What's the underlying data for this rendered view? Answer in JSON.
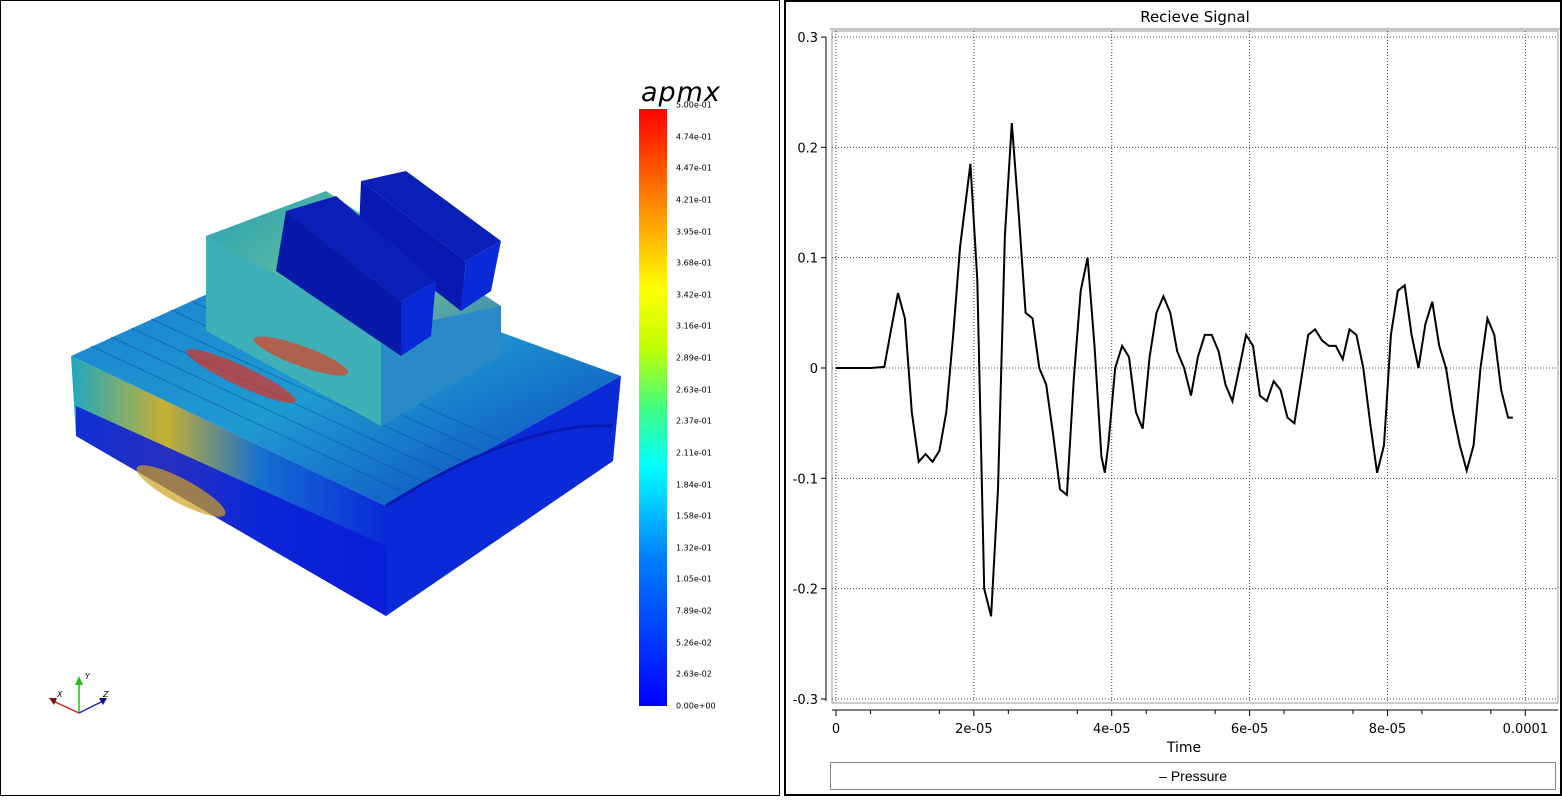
{
  "left_view": {
    "colorbar": {
      "title": "apmx",
      "ticks": [
        "5.00e-01",
        "4.74e-01",
        "4.47e-01",
        "4.21e-01",
        "3.95e-01",
        "3.68e-01",
        "3.42e-01",
        "3.16e-01",
        "2.89e-01",
        "2.63e-01",
        "2.37e-01",
        "2.11e-01",
        "1.84e-01",
        "1.58e-01",
        "1.32e-01",
        "1.05e-01",
        "7.89e-02",
        "5.26e-02",
        "2.63e-02",
        "0.00e+00"
      ]
    },
    "axes_triad": {
      "x_label": "X",
      "y_label": "Y",
      "z_label": "Z"
    }
  },
  "chart_data": {
    "type": "line",
    "title": "Recieve Signal",
    "xlabel": "Time",
    "ylabel": "",
    "xlim": [
      0,
      0.000103
    ],
    "ylim": [
      -0.3,
      0.3
    ],
    "x_ticks": [
      "0",
      "2e-05",
      "4e-05",
      "6e-05",
      "8e-05",
      "0.0001"
    ],
    "y_ticks": [
      "0.3",
      "0.2",
      "0.1",
      "0",
      "-0.1",
      "-0.2",
      "-0.3"
    ],
    "grid": true,
    "legend": "bottom",
    "series": [
      {
        "name": "Pressure",
        "color": "#000000",
        "points": [
          [
            0,
            0
          ],
          [
            5e-06,
            0
          ],
          [
            7e-06,
            0.001
          ],
          [
            8e-06,
            0.035
          ],
          [
            9e-06,
            0.068
          ],
          [
            1e-05,
            0.045
          ],
          [
            1.1e-05,
            -0.04
          ],
          [
            1.2e-05,
            -0.085
          ],
          [
            1.3e-05,
            -0.078
          ],
          [
            1.4e-05,
            -0.085
          ],
          [
            1.5e-05,
            -0.075
          ],
          [
            1.6e-05,
            -0.04
          ],
          [
            1.7e-05,
            0.03
          ],
          [
            1.8e-05,
            0.11
          ],
          [
            1.95e-05,
            0.185
          ],
          [
            2.05e-05,
            0.08
          ],
          [
            2.15e-05,
            -0.2
          ],
          [
            2.25e-05,
            -0.225
          ],
          [
            2.35e-05,
            -0.11
          ],
          [
            2.45e-05,
            0.12
          ],
          [
            2.55e-05,
            0.222
          ],
          [
            2.65e-05,
            0.14
          ],
          [
            2.75e-05,
            0.05
          ],
          [
            2.85e-05,
            0.045
          ],
          [
            2.95e-05,
            0.0
          ],
          [
            3.05e-05,
            -0.015
          ],
          [
            3.15e-05,
            -0.06
          ],
          [
            3.25e-05,
            -0.11
          ],
          [
            3.35e-05,
            -0.115
          ],
          [
            3.45e-05,
            -0.01
          ],
          [
            3.55e-05,
            0.07
          ],
          [
            3.65e-05,
            0.1
          ],
          [
            3.75e-05,
            0.02
          ],
          [
            3.85e-05,
            -0.08
          ],
          [
            3.9e-05,
            -0.095
          ],
          [
            3.95e-05,
            -0.07
          ],
          [
            4.05e-05,
            0.0
          ],
          [
            4.15e-05,
            0.02
          ],
          [
            4.25e-05,
            0.01
          ],
          [
            4.35e-05,
            -0.04
          ],
          [
            4.45e-05,
            -0.055
          ],
          [
            4.55e-05,
            0.01
          ],
          [
            4.65e-05,
            0.05
          ],
          [
            4.75e-05,
            0.065
          ],
          [
            4.85e-05,
            0.05
          ],
          [
            4.95e-05,
            0.015
          ],
          [
            5.05e-05,
            0.0
          ],
          [
            5.15e-05,
            -0.025
          ],
          [
            5.25e-05,
            0.01
          ],
          [
            5.35e-05,
            0.03
          ],
          [
            5.45e-05,
            0.03
          ],
          [
            5.55e-05,
            0.015
          ],
          [
            5.65e-05,
            -0.015
          ],
          [
            5.75e-05,
            -0.03
          ],
          [
            5.85e-05,
            0.0
          ],
          [
            5.95e-05,
            0.03
          ],
          [
            6.05e-05,
            0.02
          ],
          [
            6.15e-05,
            -0.025
          ],
          [
            6.25e-05,
            -0.03
          ],
          [
            6.35e-05,
            -0.012
          ],
          [
            6.45e-05,
            -0.02
          ],
          [
            6.55e-05,
            -0.045
          ],
          [
            6.65e-05,
            -0.05
          ],
          [
            6.75e-05,
            -0.01
          ],
          [
            6.85e-05,
            0.03
          ],
          [
            6.95e-05,
            0.035
          ],
          [
            7.05e-05,
            0.025
          ],
          [
            7.15e-05,
            0.02
          ],
          [
            7.25e-05,
            0.02
          ],
          [
            7.35e-05,
            0.008
          ],
          [
            7.45e-05,
            0.035
          ],
          [
            7.55e-05,
            0.03
          ],
          [
            7.65e-05,
            0.0
          ],
          [
            7.75e-05,
            -0.05
          ],
          [
            7.85e-05,
            -0.095
          ],
          [
            7.95e-05,
            -0.07
          ],
          [
            8.05e-05,
            0.03
          ],
          [
            8.15e-05,
            0.07
          ],
          [
            8.25e-05,
            0.075
          ],
          [
            8.35e-05,
            0.03
          ],
          [
            8.45e-05,
            0.0
          ],
          [
            8.55e-05,
            0.04
          ],
          [
            8.65e-05,
            0.06
          ],
          [
            8.75e-05,
            0.02
          ],
          [
            8.85e-05,
            0.0
          ],
          [
            8.95e-05,
            -0.04
          ],
          [
            9.05e-05,
            -0.07
          ],
          [
            9.15e-05,
            -0.093
          ],
          [
            9.25e-05,
            -0.07
          ],
          [
            9.35e-05,
            0.0
          ],
          [
            9.45e-05,
            0.045
          ],
          [
            9.55e-05,
            0.03
          ],
          [
            9.65e-05,
            -0.02
          ],
          [
            9.75e-05,
            -0.045
          ],
          [
            9.82e-05,
            -0.045
          ]
        ]
      }
    ]
  }
}
